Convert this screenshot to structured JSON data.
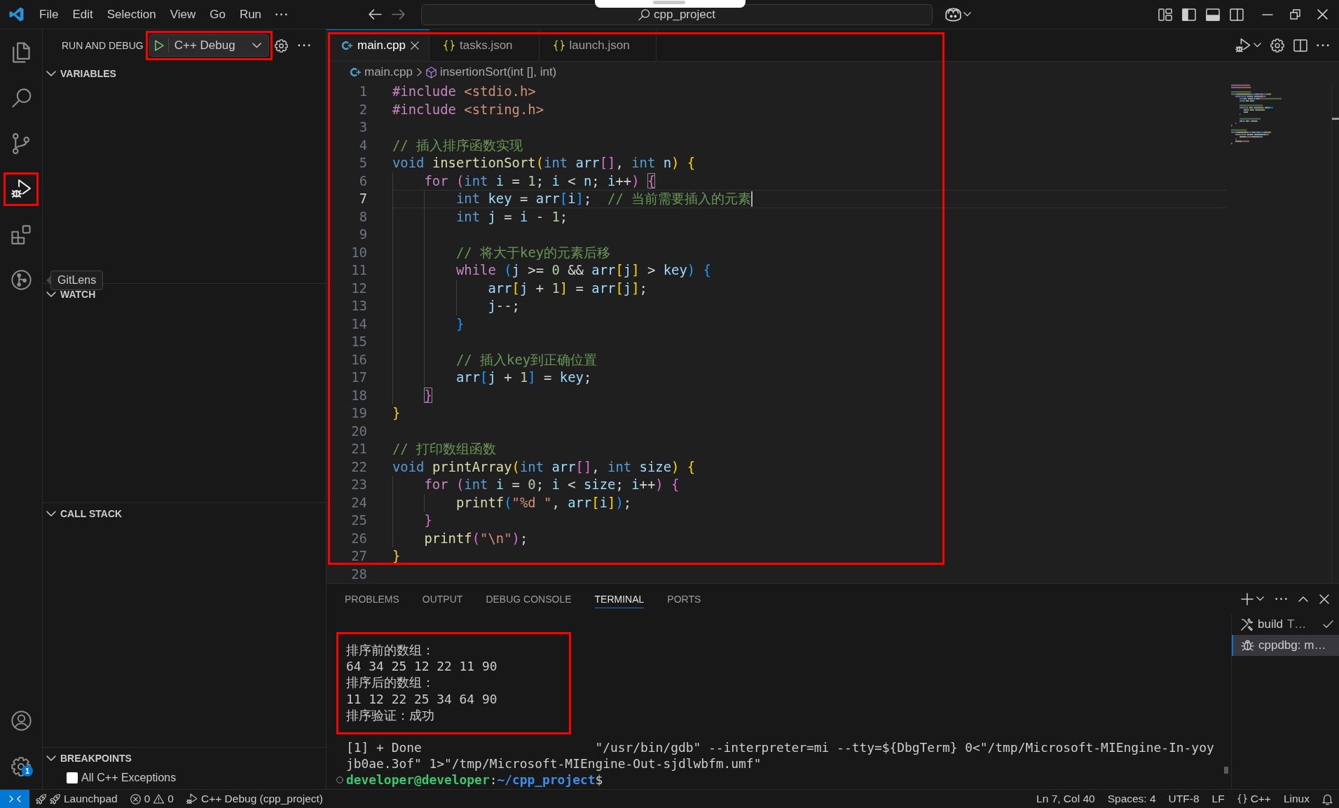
{
  "title_bar": {
    "menu": [
      "File",
      "Edit",
      "Selection",
      "View",
      "Go",
      "Run"
    ],
    "command_center": "cpp_project"
  },
  "activity_bar": {
    "top": [
      {
        "kind": "explorer",
        "selected": false,
        "highlighted": false
      },
      {
        "kind": "search",
        "selected": false,
        "highlighted": false
      },
      {
        "kind": "scm",
        "selected": false,
        "highlighted": false
      },
      {
        "kind": "debug",
        "selected": true,
        "highlighted": true
      },
      {
        "kind": "extensions",
        "selected": false,
        "highlighted": false
      },
      {
        "kind": "gitlens",
        "selected": false,
        "highlighted": false,
        "tooltip": "GitLens"
      }
    ],
    "bottom": [
      {
        "kind": "account"
      },
      {
        "kind": "settings",
        "badge": "1"
      }
    ]
  },
  "sidebar": {
    "title": "RUN AND DEBUG",
    "config": {
      "label": "C++ Debug",
      "highlighted": true
    },
    "sections": [
      {
        "title": "VARIABLES",
        "expanded": true
      },
      {
        "title": "WATCH",
        "expanded": true
      },
      {
        "title": "CALL STACK",
        "expanded": true
      },
      {
        "title": "BREAKPOINTS",
        "expanded": true,
        "items": [
          {
            "label": "All C++ Exceptions",
            "checked": false
          }
        ]
      }
    ]
  },
  "editor": {
    "highlighted": true,
    "tabs": [
      {
        "label": "main.cpp",
        "kind": "cpp",
        "selected": true
      },
      {
        "label": "tasks.json",
        "kind": "json",
        "selected": false
      },
      {
        "label": "launch.json",
        "kind": "json",
        "selected": false
      }
    ],
    "breadcrumb": [
      {
        "kind": "file",
        "text": "main.cpp"
      },
      {
        "kind": "symbol",
        "text": "insertionSort(int [], int)"
      }
    ],
    "lines": [
      {
        "number": "1",
        "current": false,
        "tokens": [
          {
            "text": "#include ",
            "kind": "directive"
          },
          {
            "text": "<stdio.h>",
            "kind": "string"
          }
        ]
      },
      {
        "number": "2",
        "current": false,
        "tokens": [
          {
            "text": "#include ",
            "kind": "directive"
          },
          {
            "text": "<string.h>",
            "kind": "string"
          }
        ]
      },
      {
        "number": "3",
        "current": false
      },
      {
        "number": "4",
        "current": false,
        "tokens": [
          {
            "text": "// 插入排序函数实现",
            "kind": "comment"
          }
        ]
      },
      {
        "number": "5",
        "current": false,
        "tokens": [
          {
            "text": "void ",
            "kind": "type"
          },
          {
            "text": "insertionSort",
            "kind": "function"
          },
          {
            "text": "(",
            "kind": "b1"
          },
          {
            "text": "int ",
            "kind": "type"
          },
          {
            "text": "arr",
            "kind": "variable"
          },
          {
            "text": "[]",
            "kind": "b2"
          },
          {
            "text": ", ",
            "kind": "plain"
          },
          {
            "text": "int ",
            "kind": "type"
          },
          {
            "text": "n",
            "kind": "variable"
          },
          {
            "text": ") ",
            "kind": "b1"
          },
          {
            "text": "{",
            "kind": "b1"
          }
        ]
      },
      {
        "number": "6",
        "current": false,
        "tokens": [
          {
            "text": "    for ",
            "kind": "keyword"
          },
          {
            "text": "(",
            "kind": "b2"
          },
          {
            "text": "int ",
            "kind": "type"
          },
          {
            "text": "i",
            "kind": "variable"
          },
          {
            "text": " = ",
            "kind": "plain"
          },
          {
            "text": "1",
            "kind": "number"
          },
          {
            "text": "; ",
            "kind": "plain"
          },
          {
            "text": "i",
            "kind": "variable"
          },
          {
            "text": " < ",
            "kind": "plain"
          },
          {
            "text": "n",
            "kind": "variable"
          },
          {
            "text": "; ",
            "kind": "plain"
          },
          {
            "text": "i",
            "kind": "variable"
          },
          {
            "text": "++",
            "kind": "plain"
          },
          {
            "text": ") ",
            "kind": "b2"
          },
          {
            "text": "{",
            "kind": "match"
          }
        ]
      },
      {
        "number": "7",
        "current": true,
        "tokens": [
          {
            "text": "        int ",
            "kind": "type"
          },
          {
            "text": "key",
            "kind": "variable"
          },
          {
            "text": " = ",
            "kind": "plain"
          },
          {
            "text": "arr",
            "kind": "variable"
          },
          {
            "text": "[",
            "kind": "b3"
          },
          {
            "text": "i",
            "kind": "variable"
          },
          {
            "text": "]",
            "kind": "b3"
          },
          {
            "text": ";  ",
            "kind": "plain"
          },
          {
            "text": "// 当前需要插入的元素",
            "kind": "comment"
          }
        ]
      },
      {
        "number": "8",
        "current": false,
        "tokens": [
          {
            "text": "        int ",
            "kind": "type"
          },
          {
            "text": "j",
            "kind": "variable"
          },
          {
            "text": " = ",
            "kind": "plain"
          },
          {
            "text": "i",
            "kind": "variable"
          },
          {
            "text": " - ",
            "kind": "plain"
          },
          {
            "text": "1",
            "kind": "number"
          },
          {
            "text": ";",
            "kind": "plain"
          }
        ]
      },
      {
        "number": "9",
        "current": false
      },
      {
        "number": "10",
        "current": false,
        "tokens": [
          {
            "text": "        // 将大于key的元素后移",
            "kind": "comment"
          }
        ]
      },
      {
        "number": "11",
        "current": false,
        "tokens": [
          {
            "text": "        while ",
            "kind": "keyword"
          },
          {
            "text": "(",
            "kind": "b3"
          },
          {
            "text": "j",
            "kind": "variable"
          },
          {
            "text": " >= ",
            "kind": "plain"
          },
          {
            "text": "0",
            "kind": "number"
          },
          {
            "text": " && ",
            "kind": "plain"
          },
          {
            "text": "arr",
            "kind": "variable"
          },
          {
            "text": "[",
            "kind": "b1"
          },
          {
            "text": "j",
            "kind": "variable"
          },
          {
            "text": "]",
            "kind": "b1"
          },
          {
            "text": " > ",
            "kind": "plain"
          },
          {
            "text": "key",
            "kind": "variable"
          },
          {
            "text": ") ",
            "kind": "b3"
          },
          {
            "text": "{",
            "kind": "b3"
          }
        ]
      },
      {
        "number": "12",
        "current": false,
        "tokens": [
          {
            "text": "            arr",
            "kind": "variable"
          },
          {
            "text": "[",
            "kind": "b1"
          },
          {
            "text": "j",
            "kind": "variable"
          },
          {
            "text": " + ",
            "kind": "plain"
          },
          {
            "text": "1",
            "kind": "number"
          },
          {
            "text": "]",
            "kind": "b1"
          },
          {
            "text": " = ",
            "kind": "plain"
          },
          {
            "text": "arr",
            "kind": "variable"
          },
          {
            "text": "[",
            "kind": "b1"
          },
          {
            "text": "j",
            "kind": "variable"
          },
          {
            "text": "]",
            "kind": "b1"
          },
          {
            "text": ";",
            "kind": "plain"
          }
        ]
      },
      {
        "number": "13",
        "current": false,
        "tokens": [
          {
            "text": "            j",
            "kind": "variable"
          },
          {
            "text": "--;",
            "kind": "plain"
          }
        ]
      },
      {
        "number": "14",
        "current": false,
        "tokens": [
          {
            "text": "        }",
            "kind": "b3"
          }
        ]
      },
      {
        "number": "15",
        "current": false
      },
      {
        "number": "16",
        "current": false,
        "tokens": [
          {
            "text": "        // 插入key到正确位置",
            "kind": "comment"
          }
        ]
      },
      {
        "number": "17",
        "current": false,
        "tokens": [
          {
            "text": "        arr",
            "kind": "variable"
          },
          {
            "text": "[",
            "kind": "b3"
          },
          {
            "text": "j",
            "kind": "variable"
          },
          {
            "text": " + ",
            "kind": "plain"
          },
          {
            "text": "1",
            "kind": "number"
          },
          {
            "text": "]",
            "kind": "b3"
          },
          {
            "text": " = ",
            "kind": "plain"
          },
          {
            "text": "key",
            "kind": "variable"
          },
          {
            "text": ";",
            "kind": "plain"
          }
        ]
      },
      {
        "number": "18",
        "current": false,
        "tokens": [
          {
            "text": "    }",
            "kind": "match"
          }
        ]
      },
      {
        "number": "19",
        "current": false,
        "tokens": [
          {
            "text": "}",
            "kind": "b1"
          }
        ]
      },
      {
        "number": "20",
        "current": false
      },
      {
        "number": "21",
        "current": false,
        "tokens": [
          {
            "text": "// 打印数组函数",
            "kind": "comment"
          }
        ]
      },
      {
        "number": "22",
        "current": false,
        "tokens": [
          {
            "text": "void ",
            "kind": "type"
          },
          {
            "text": "printArray",
            "kind": "function"
          },
          {
            "text": "(",
            "kind": "b1"
          },
          {
            "text": "int ",
            "kind": "type"
          },
          {
            "text": "arr",
            "kind": "variable"
          },
          {
            "text": "[]",
            "kind": "b2"
          },
          {
            "text": ", ",
            "kind": "plain"
          },
          {
            "text": "int ",
            "kind": "type"
          },
          {
            "text": "size",
            "kind": "variable"
          },
          {
            "text": ") ",
            "kind": "b1"
          },
          {
            "text": "{",
            "kind": "b1"
          }
        ]
      },
      {
        "number": "23",
        "current": false,
        "tokens": [
          {
            "text": "    for ",
            "kind": "keyword"
          },
          {
            "text": "(",
            "kind": "b2"
          },
          {
            "text": "int ",
            "kind": "type"
          },
          {
            "text": "i",
            "kind": "variable"
          },
          {
            "text": " = ",
            "kind": "plain"
          },
          {
            "text": "0",
            "kind": "number"
          },
          {
            "text": "; ",
            "kind": "plain"
          },
          {
            "text": "i",
            "kind": "variable"
          },
          {
            "text": " < ",
            "kind": "plain"
          },
          {
            "text": "size",
            "kind": "variable"
          },
          {
            "text": "; ",
            "kind": "plain"
          },
          {
            "text": "i",
            "kind": "variable"
          },
          {
            "text": "++",
            "kind": "plain"
          },
          {
            "text": ") ",
            "kind": "b2"
          },
          {
            "text": "{",
            "kind": "b2"
          }
        ]
      },
      {
        "number": "24",
        "current": false,
        "tokens": [
          {
            "text": "        printf",
            "kind": "function"
          },
          {
            "text": "(",
            "kind": "b3"
          },
          {
            "text": "\"%d \"",
            "kind": "string"
          },
          {
            "text": ", ",
            "kind": "plain"
          },
          {
            "text": "arr",
            "kind": "variable"
          },
          {
            "text": "[",
            "kind": "b1"
          },
          {
            "text": "i",
            "kind": "variable"
          },
          {
            "text": "]",
            "kind": "b1"
          },
          {
            "text": ")",
            "kind": "b3"
          },
          {
            "text": ";",
            "kind": "plain"
          }
        ]
      },
      {
        "number": "25",
        "current": false,
        "tokens": [
          {
            "text": "    }",
            "kind": "b2"
          }
        ]
      },
      {
        "number": "26",
        "current": false,
        "tokens": [
          {
            "text": "    printf",
            "kind": "function"
          },
          {
            "text": "(",
            "kind": "b2"
          },
          {
            "text": "\"\\n\"",
            "kind": "string"
          },
          {
            "text": ")",
            "kind": "b2"
          },
          {
            "text": ";",
            "kind": "plain"
          }
        ]
      },
      {
        "number": "27",
        "current": false,
        "tokens": [
          {
            "text": "}",
            "kind": "b1"
          }
        ]
      },
      {
        "number": "28",
        "current": false
      }
    ]
  },
  "panel": {
    "tabs": [
      {
        "label": "PROBLEMS",
        "selected": false
      },
      {
        "label": "OUTPUT",
        "selected": false
      },
      {
        "label": "DEBUG CONSOLE",
        "selected": false
      },
      {
        "label": "TERMINAL",
        "selected": true
      },
      {
        "label": "PORTS",
        "selected": false
      }
    ],
    "terminal": {
      "blocks": [
        {
          "highlighted": true,
          "lines": [
            "排序前的数组：",
            "64 34 25 12 22 11 90",
            "排序后的数组：",
            "11 12 22 25 34 64 90",
            "排序验证：成功"
          ]
        },
        {
          "highlighted": false,
          "lines": [
            "[1] + Done                       \"/usr/bin/gdb\" --interpreter=mi --tty=${DbgTerm} 0<\"/tmp/Microsoft-MIEngine-In-yoy",
            "jb0ae.3of\" 1>\"/tmp/Microsoft-MIEngine-Out-sjdlwbfm.umf\""
          ]
        }
      ],
      "prompt": {
        "user": "developer@developer",
        "separator": ":",
        "path": "~/cpp_project",
        "symbol": "$"
      }
    },
    "terminals": [
      {
        "kind": "task",
        "label": "build",
        "description": "T…",
        "done": true,
        "selected": false
      },
      {
        "kind": "debug",
        "label": "cppdbg: m…",
        "done": false,
        "selected": true
      }
    ]
  },
  "status_bar": {
    "left": [
      {
        "kind": "remote"
      },
      {
        "kind": "launchpad",
        "text": "Launchpad"
      },
      {
        "kind": "problems",
        "errors": "0",
        "warnings": "0"
      },
      {
        "kind": "debug",
        "text": "C++ Debug (cpp_project)"
      }
    ],
    "right": [
      {
        "kind": "text",
        "text": "Ln 7, Col 40"
      },
      {
        "kind": "text",
        "text": "Spaces: 4"
      },
      {
        "kind": "text",
        "text": "UTF-8"
      },
      {
        "kind": "text",
        "text": "LF"
      },
      {
        "kind": "language",
        "text": "C++"
      },
      {
        "kind": "text",
        "text": "Linux"
      },
      {
        "kind": "bell"
      }
    ]
  }
}
